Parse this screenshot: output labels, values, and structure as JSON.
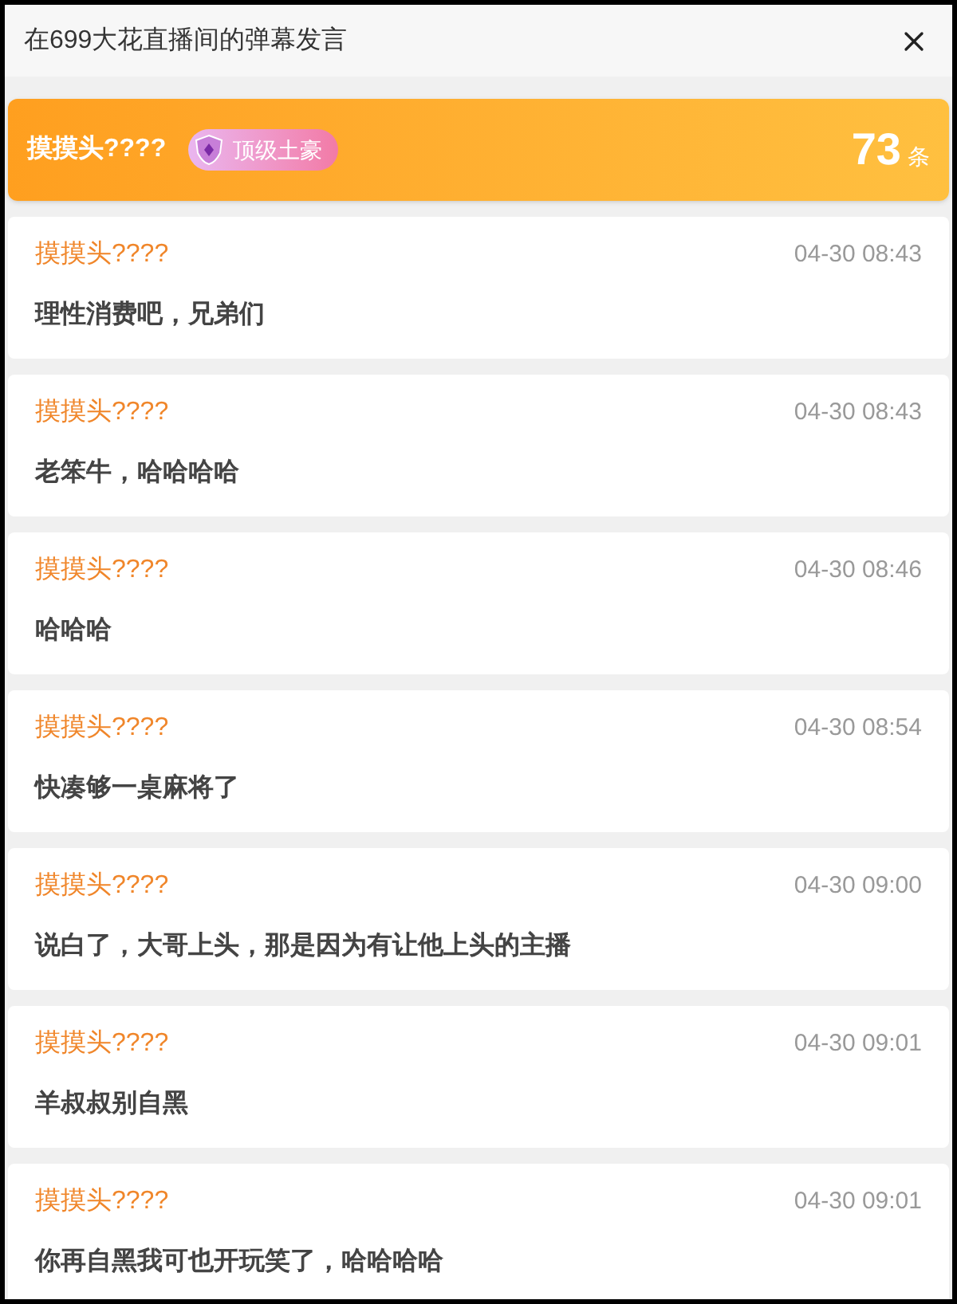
{
  "window": {
    "title": "在699大花直播间的弹幕发言"
  },
  "summary": {
    "user": "摸摸头????",
    "badge": "顶级土豪",
    "count": "73",
    "unit": "条"
  },
  "messages": [
    {
      "user": "摸摸头????",
      "time": "04-30 08:43",
      "text": "理性消费吧，兄弟们"
    },
    {
      "user": "摸摸头????",
      "time": "04-30 08:43",
      "text": "老笨牛，哈哈哈哈"
    },
    {
      "user": "摸摸头????",
      "time": "04-30 08:46",
      "text": "哈哈哈"
    },
    {
      "user": "摸摸头????",
      "time": "04-30 08:54",
      "text": "快凑够一桌麻将了"
    },
    {
      "user": "摸摸头????",
      "time": "04-30 09:00",
      "text": "说白了，大哥上头，那是因为有让他上头的主播"
    },
    {
      "user": "摸摸头????",
      "time": "04-30 09:01",
      "text": "羊叔叔别自黑"
    },
    {
      "user": "摸摸头????",
      "time": "04-30 09:01",
      "text": "你再自黑我可也开玩笑了，哈哈哈哈"
    }
  ]
}
